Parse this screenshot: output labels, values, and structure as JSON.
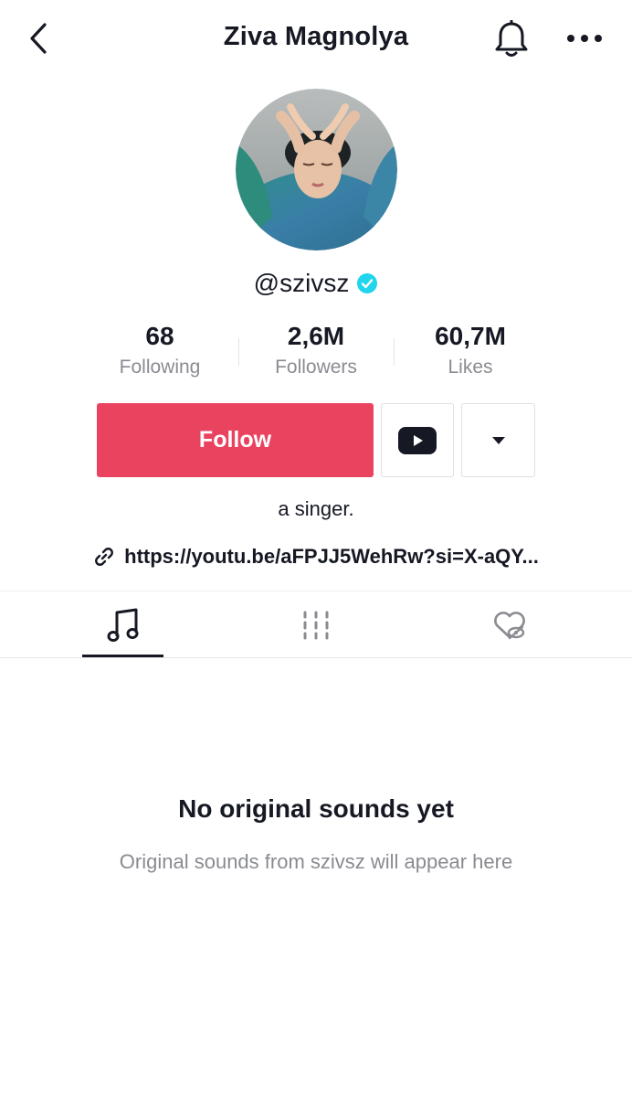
{
  "header": {
    "title": "Ziva Magnolya",
    "back_icon": "chevron-left-icon",
    "bell_icon": "bell-icon",
    "more_icon": "more-horizontal-icon"
  },
  "profile": {
    "avatar_icon": "profile-avatar-photo",
    "username": "@szivsz",
    "verified_icon": "verified-badge-icon",
    "verified_color": "#20d5ec",
    "stats": [
      {
        "value": "68",
        "label": "Following"
      },
      {
        "value": "2,6M",
        "label": "Followers"
      },
      {
        "value": "60,7M",
        "label": "Likes"
      }
    ],
    "bio": "a singer.",
    "link": "https://youtu.be/aFPJJ5WehRw?si=X-aQY..."
  },
  "actions": {
    "follow_label": "Follow",
    "follow_color": "#ea435f",
    "youtube_icon": "youtube-icon",
    "dropdown_icon": "caret-down-icon"
  },
  "tabs": [
    {
      "name": "sounds",
      "icon": "music-note-icon",
      "active": true
    },
    {
      "name": "videos",
      "icon": "grid-lines-icon",
      "active": false
    },
    {
      "name": "liked",
      "icon": "hidden-heart-icon",
      "active": false
    }
  ],
  "empty_state": {
    "title": "No original sounds yet",
    "subtitle": "Original sounds from szivsz will appear here"
  }
}
